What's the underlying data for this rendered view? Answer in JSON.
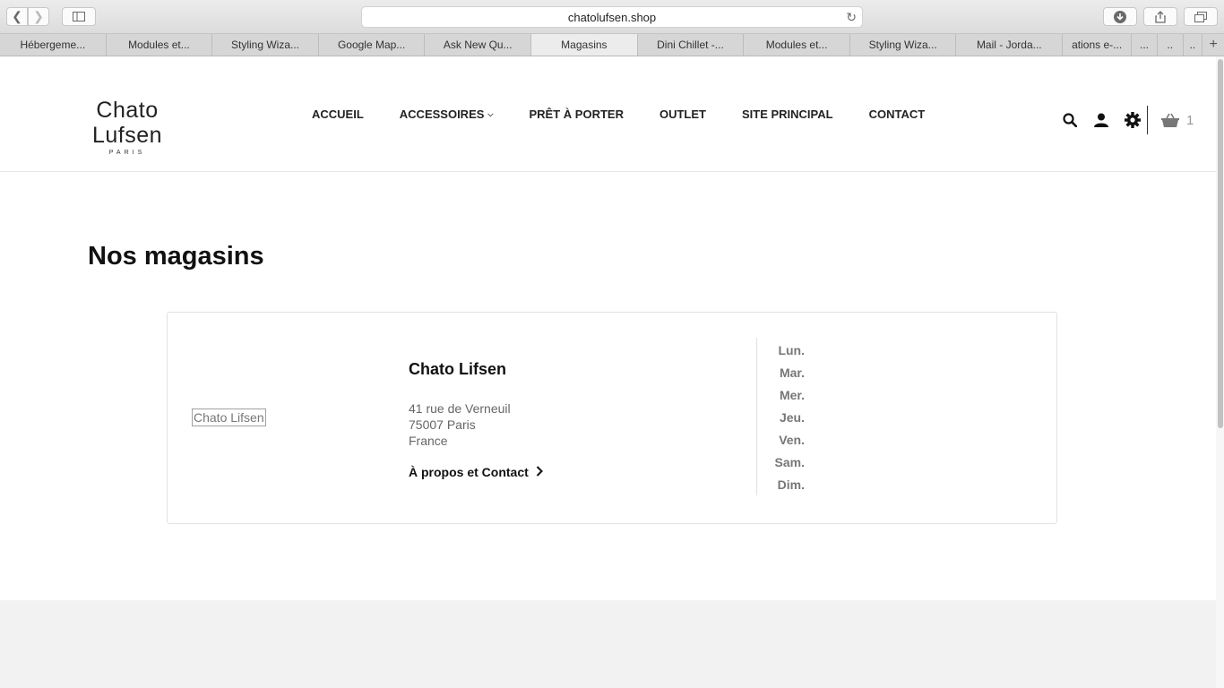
{
  "browser": {
    "url": "chatolufsen.shop",
    "tabs": [
      {
        "label": "Hébergeme...",
        "active": false
      },
      {
        "label": "Modules et...",
        "active": false
      },
      {
        "label": "Styling Wiza...",
        "active": false
      },
      {
        "label": "Google Map...",
        "active": false
      },
      {
        "label": "Ask New Qu...",
        "active": false
      },
      {
        "label": "Magasins",
        "active": true
      },
      {
        "label": "Dini Chillet -...",
        "active": false
      },
      {
        "label": "Modules et...",
        "active": false
      },
      {
        "label": "Styling Wiza...",
        "active": false
      },
      {
        "label": "Mail - Jorda...",
        "active": false
      },
      {
        "label": "ations e-...",
        "active": false
      }
    ],
    "small_tabs": [
      "...",
      "..",
      ".."
    ],
    "new_tab": "+"
  },
  "header": {
    "logo_main": "Chato Lufsen",
    "logo_sub": "PARIS",
    "nav": [
      "ACCUEIL",
      "ACCESSOIRES",
      "PRÊT À PORTER",
      "OUTLET",
      "SITE PRINCIPAL",
      "CONTACT"
    ],
    "cart_count": "1",
    "icons": [
      "search-icon",
      "user-icon",
      "gear-icon",
      "basket-icon"
    ]
  },
  "main": {
    "title": "Nos magasins",
    "store": {
      "image_alt": "Chato Lifsen",
      "name": "Chato Lifsen",
      "address_line1": "41 rue de Verneuil",
      "address_line2": "75007 Paris",
      "address_line3": "France",
      "link_label": "À propos et Contact",
      "days": [
        "Lun.",
        "Mar.",
        "Mer.",
        "Jeu.",
        "Ven.",
        "Sam.",
        "Dim."
      ]
    }
  }
}
